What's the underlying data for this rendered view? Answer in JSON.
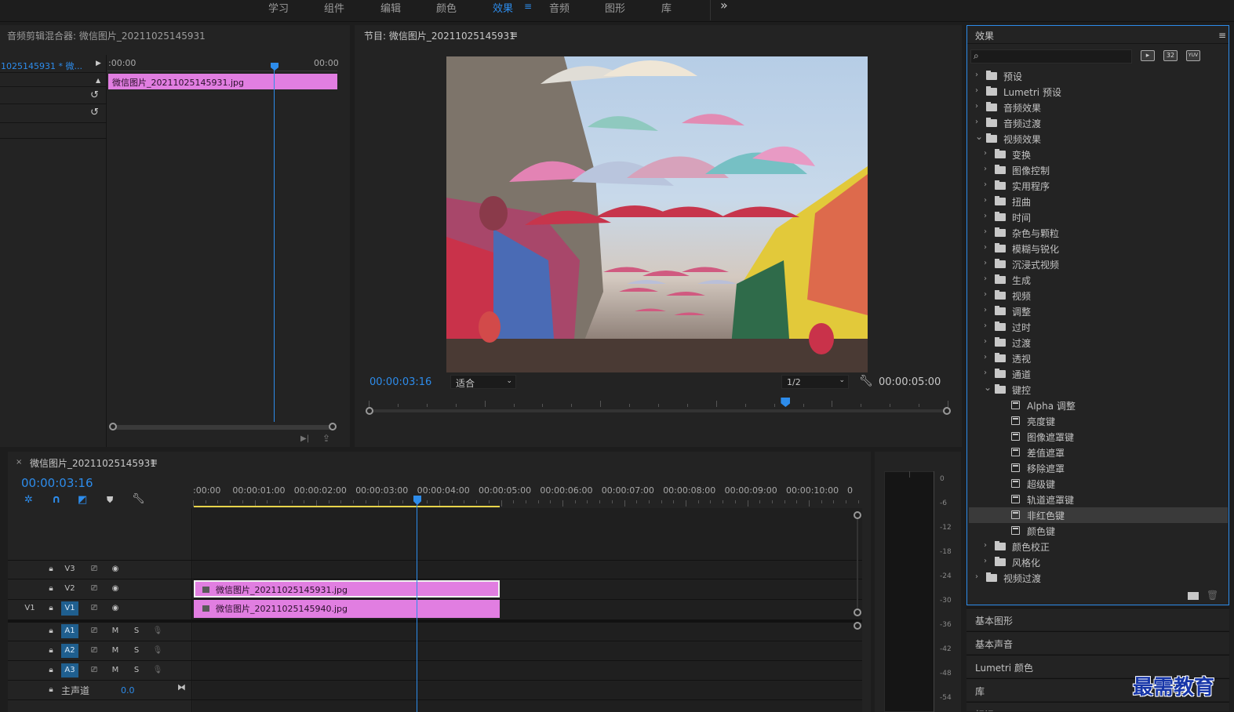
{
  "workspaces": [
    {
      "label": "学习",
      "active": false
    },
    {
      "label": "组件",
      "active": false
    },
    {
      "label": "编辑",
      "active": false
    },
    {
      "label": "颜色",
      "active": false
    },
    {
      "label": "效果",
      "active": true
    },
    {
      "label": "音频",
      "active": false
    },
    {
      "label": "图形",
      "active": false
    },
    {
      "label": "库",
      "active": false
    }
  ],
  "workspace_more": "»",
  "mixer": {
    "title": "音频剪辑混合器: 微信图片_20211025145931",
    "seq_label": "1025145931 * 微...",
    "ruler_start": ":00:00",
    "ruler_end": "00:00",
    "clip_label": "微信图片_20211025145931.jpg"
  },
  "program": {
    "title": "节目: 微信图片_20211025145931",
    "timecode": "00:00:03:16",
    "fit_select": "适合",
    "res_select": "1/2",
    "duration": "00:00:05:00",
    "playhead_progress": 0.72
  },
  "timeline": {
    "title": "微信图片_20211025145931",
    "timecode": "00:00:03:16",
    "ruler": [
      ":00:00",
      "00:00:01:00",
      "00:00:02:00",
      "00:00:03:00",
      "00:00:04:00",
      "00:00:05:00",
      "00:00:06:00",
      "00:00:07:00",
      "00:00:08:00",
      "00:00:09:00",
      "00:00:10:00",
      "0"
    ],
    "tracks": {
      "v3": "V3",
      "v2": "V2",
      "v1": "V1",
      "v1_src": "V1",
      "a1": "A1",
      "a2": "A2",
      "a3": "A3",
      "m": "M",
      "s": "S",
      "master": "主声道",
      "master_value": "0.0"
    },
    "clip_v2": "微信图片_20211025145931.jpg",
    "clip_v1": "微信图片_20211025145940.jpg"
  },
  "meter": {
    "ticks": [
      "0",
      "-6",
      "-12",
      "-18",
      "-24",
      "-30",
      "-36",
      "-42",
      "-48",
      "-54"
    ]
  },
  "effects": {
    "title": "效果",
    "search_placeholder": "",
    "badge_32": "32",
    "badge_yuv": "YUV",
    "tree": [
      {
        "label": "预设",
        "level": 0,
        "icon": "preset",
        "expanded": false
      },
      {
        "label": "Lumetri 预设",
        "level": 0,
        "icon": "preset",
        "expanded": false
      },
      {
        "label": "音频效果",
        "level": 0,
        "icon": "folder",
        "expanded": false
      },
      {
        "label": "音频过渡",
        "level": 0,
        "icon": "folder",
        "expanded": false
      },
      {
        "label": "视频效果",
        "level": 0,
        "icon": "folder",
        "expanded": true
      },
      {
        "label": "变换",
        "level": 1,
        "icon": "folder",
        "expanded": false
      },
      {
        "label": "图像控制",
        "level": 1,
        "icon": "folder",
        "expanded": false
      },
      {
        "label": "实用程序",
        "level": 1,
        "icon": "folder",
        "expanded": false
      },
      {
        "label": "扭曲",
        "level": 1,
        "icon": "folder",
        "expanded": false
      },
      {
        "label": "时间",
        "level": 1,
        "icon": "folder",
        "expanded": false
      },
      {
        "label": "杂色与颗粒",
        "level": 1,
        "icon": "folder",
        "expanded": false
      },
      {
        "label": "模糊与锐化",
        "level": 1,
        "icon": "folder",
        "expanded": false
      },
      {
        "label": "沉浸式视频",
        "level": 1,
        "icon": "folder",
        "expanded": false
      },
      {
        "label": "生成",
        "level": 1,
        "icon": "folder",
        "expanded": false
      },
      {
        "label": "视频",
        "level": 1,
        "icon": "folder",
        "expanded": false
      },
      {
        "label": "调整",
        "level": 1,
        "icon": "folder",
        "expanded": false
      },
      {
        "label": "过时",
        "level": 1,
        "icon": "folder",
        "expanded": false
      },
      {
        "label": "过渡",
        "level": 1,
        "icon": "folder",
        "expanded": false
      },
      {
        "label": "透视",
        "level": 1,
        "icon": "folder",
        "expanded": false
      },
      {
        "label": "通道",
        "level": 1,
        "icon": "folder",
        "expanded": false
      },
      {
        "label": "键控",
        "level": 1,
        "icon": "folder",
        "expanded": true
      },
      {
        "label": "Alpha 调整",
        "level": 2,
        "icon": "fx"
      },
      {
        "label": "亮度键",
        "level": 2,
        "icon": "fx"
      },
      {
        "label": "图像遮罩键",
        "level": 2,
        "icon": "fx"
      },
      {
        "label": "差值遮罩",
        "level": 2,
        "icon": "fx"
      },
      {
        "label": "移除遮罩",
        "level": 2,
        "icon": "fx"
      },
      {
        "label": "超级键",
        "level": 2,
        "icon": "fx"
      },
      {
        "label": "轨道遮罩键",
        "level": 2,
        "icon": "fx"
      },
      {
        "label": "非红色键",
        "level": 2,
        "icon": "fx",
        "selected": true
      },
      {
        "label": "颜色键",
        "level": 2,
        "icon": "fx"
      },
      {
        "label": "颜色校正",
        "level": 1,
        "icon": "folder",
        "expanded": false
      },
      {
        "label": "风格化",
        "level": 1,
        "icon": "folder",
        "expanded": false
      },
      {
        "label": "视频过渡",
        "level": 0,
        "icon": "folder",
        "expanded": false
      }
    ]
  },
  "side_panels": [
    "基本图形",
    "基本声音",
    "Lumetri 颜色",
    "库",
    "标记"
  ],
  "watermark": "最需教育",
  "colors": {
    "accent": "#2d8ceb",
    "clip": "#e17ee1",
    "work_area": "#e8d44a"
  }
}
